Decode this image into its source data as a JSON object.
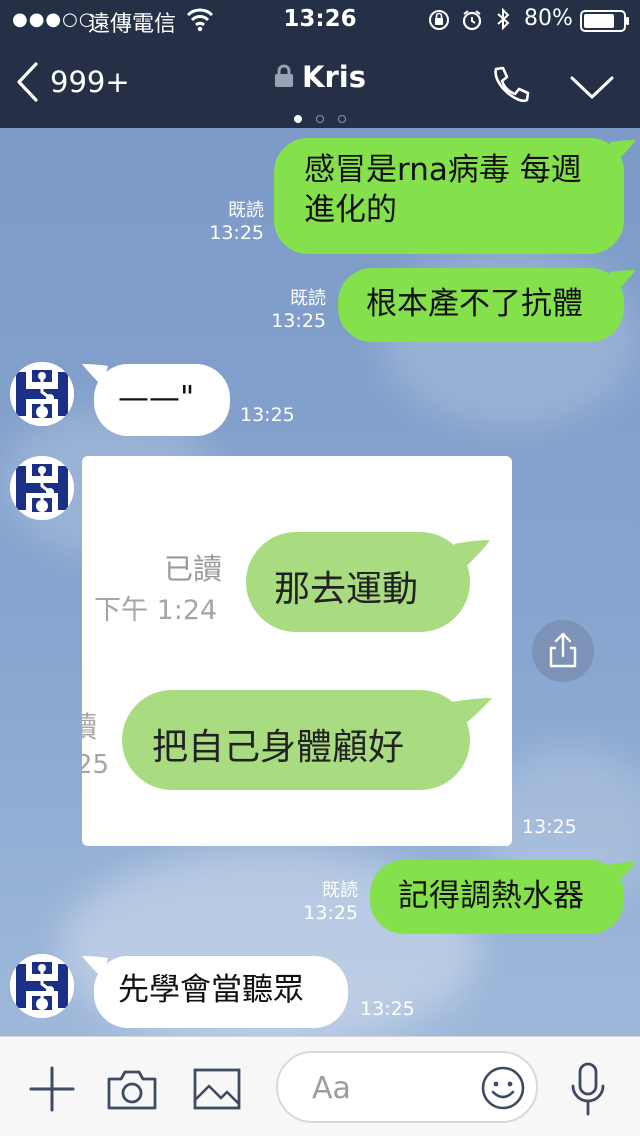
{
  "status_bar": {
    "signal": "●●●○○",
    "carrier": "遠傳電信",
    "time": "13:26",
    "battery": "80%",
    "battery_level": 0.8
  },
  "header": {
    "back_count": "999+",
    "title": "Kris",
    "page_dots": 3,
    "active_dot": 0
  },
  "messages": [
    {
      "side": "out",
      "lines": [
        "感冒是rna病毒 每週",
        "進化的"
      ],
      "read": "既読",
      "time": "13:25"
    },
    {
      "side": "out",
      "lines": [
        "根本產不了抗體"
      ],
      "read": "既読",
      "time": "13:25"
    },
    {
      "side": "in",
      "lines": [
        "——\""
      ],
      "time": "13:25"
    },
    {
      "side": "in",
      "type": "image",
      "time": "13:25"
    },
    {
      "side": "out",
      "lines": [
        "記得調熱水器"
      ],
      "read": "既読",
      "time": "13:25"
    },
    {
      "side": "in",
      "lines": [
        "先學會當聽眾"
      ],
      "time": "13:25"
    }
  ],
  "photo": {
    "read": "已讀",
    "time": "下午 1:24",
    "bubble1": "那去運動",
    "bubble2": "把自己身體顧好",
    "crop_read": "讀",
    "crop_time": "25"
  },
  "input": {
    "placeholder": "Aa"
  },
  "colors": {
    "topbar": "#253047",
    "outgoing_bubble": "#84e04b",
    "incoming_bubble": "#ffffff",
    "photo_bubble": "#a9dc80",
    "avatar_blue": "#1b2f86"
  }
}
